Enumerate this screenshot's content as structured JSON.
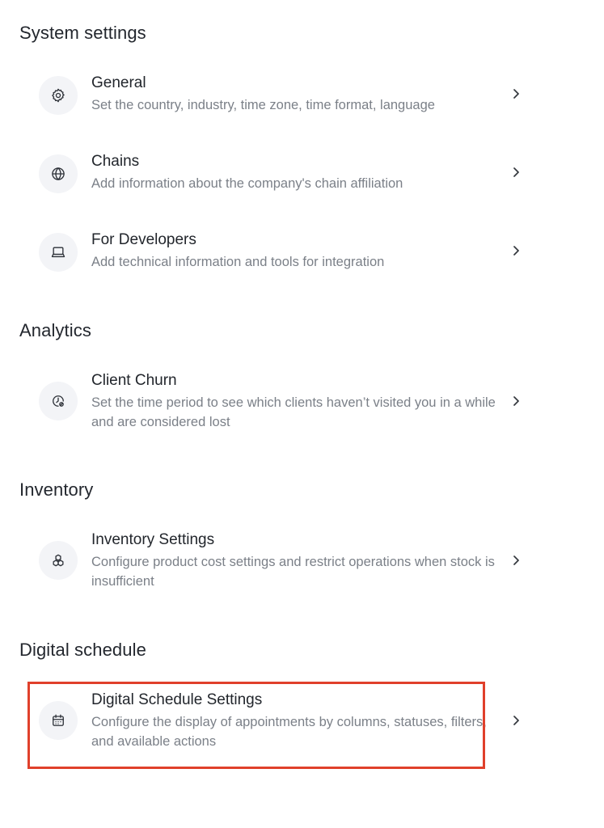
{
  "sections": {
    "system": {
      "title": "System settings",
      "items": [
        {
          "icon": "gear-icon",
          "title": "General",
          "desc": "Set the country, industry, time zone, time format, language"
        },
        {
          "icon": "globe-icon",
          "title": "Chains",
          "desc": "Add information about the company's chain affiliation"
        },
        {
          "icon": "laptop-icon",
          "title": "For Developers",
          "desc": "Add technical information and tools for integration"
        }
      ]
    },
    "analytics": {
      "title": "Analytics",
      "items": [
        {
          "icon": "clock-churn-icon",
          "title": "Client Churn",
          "desc": "Set the time period to see which clients haven’t visited you in a while and are considered lost"
        }
      ]
    },
    "inventory": {
      "title": "Inventory",
      "items": [
        {
          "icon": "boxes-icon",
          "title": "Inventory Settings",
          "desc": "Configure product cost settings and restrict operations when stock is insufficient"
        }
      ]
    },
    "schedule": {
      "title": "Digital schedule",
      "items": [
        {
          "icon": "calendar-icon",
          "title": "Digital Schedule Settings",
          "desc": "Configure the display of appointments by columns, statuses, filters, and available actions"
        }
      ]
    }
  },
  "colors": {
    "highlight": "#e0402b",
    "icon_bg": "#f3f4f7",
    "desc_text": "#7b8088"
  }
}
